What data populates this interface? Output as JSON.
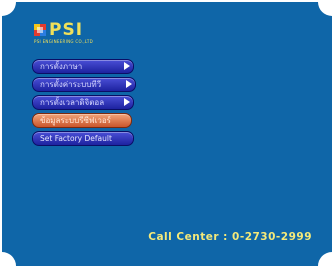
{
  "logo": {
    "text": "PSI",
    "subtext": "PSI ENGINEERING CO.,LTD",
    "icon": "psi-logo-mark-icon"
  },
  "menu": {
    "items": [
      {
        "label": "การตั้งภาษา",
        "has_arrow": true,
        "selected": false
      },
      {
        "label": "การตั้งค่าระบบทีวี",
        "has_arrow": true,
        "selected": false
      },
      {
        "label": "การตั้งเวลาดิจิตอล",
        "has_arrow": true,
        "selected": false
      },
      {
        "label": "ข้อมูลระบบรีซีฟเวอร์",
        "has_arrow": false,
        "selected": true
      },
      {
        "label": "Set Factory Default",
        "has_arrow": false,
        "selected": false
      }
    ]
  },
  "footer": {
    "call_center": "Call Center : 0-2730-2999"
  },
  "colors": {
    "screen_bg": "#0f66a8",
    "menu_item": "#2f34c0",
    "menu_item_selected": "#e07a4c",
    "text_yellow": "#f4e97a"
  }
}
